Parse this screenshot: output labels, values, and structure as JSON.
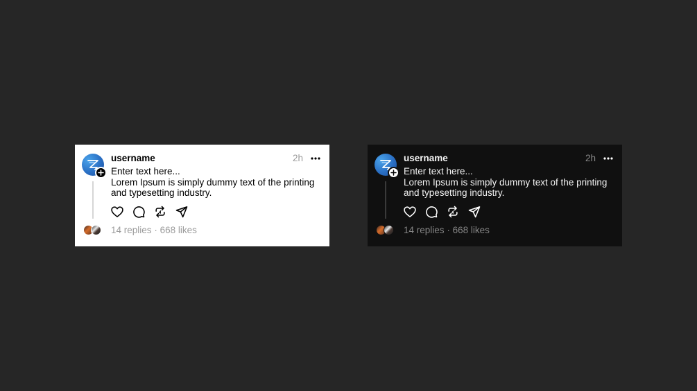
{
  "colors": {
    "background": "#262626",
    "light_card": "#ffffff",
    "dark_card": "#101010",
    "avatar_blue": "#2a6fc4",
    "muted_text": "#9b9b9b"
  },
  "posts": [
    {
      "theme": "light",
      "username": "username",
      "time": "2h",
      "text_line1": "Enter text here...",
      "text_line2": "Lorem Ipsum is simply dummy text of the printing",
      "text_line3": "and typesetting industry.",
      "replies": "14 replies",
      "separator": "·",
      "likes": "668 likes",
      "icons": [
        "heart-icon",
        "comment-icon",
        "repost-icon",
        "share-icon",
        "more-icon",
        "plus-icon"
      ]
    },
    {
      "theme": "dark",
      "username": "username",
      "time": "2h",
      "text_line1": "Enter text here...",
      "text_line2": "Lorem Ipsum is simply dummy text of the printing",
      "text_line3": "and typesetting industry.",
      "replies": "14 replies",
      "separator": "·",
      "likes": "668 likes",
      "icons": [
        "heart-icon",
        "comment-icon",
        "repost-icon",
        "share-icon",
        "more-icon",
        "plus-icon"
      ]
    }
  ]
}
